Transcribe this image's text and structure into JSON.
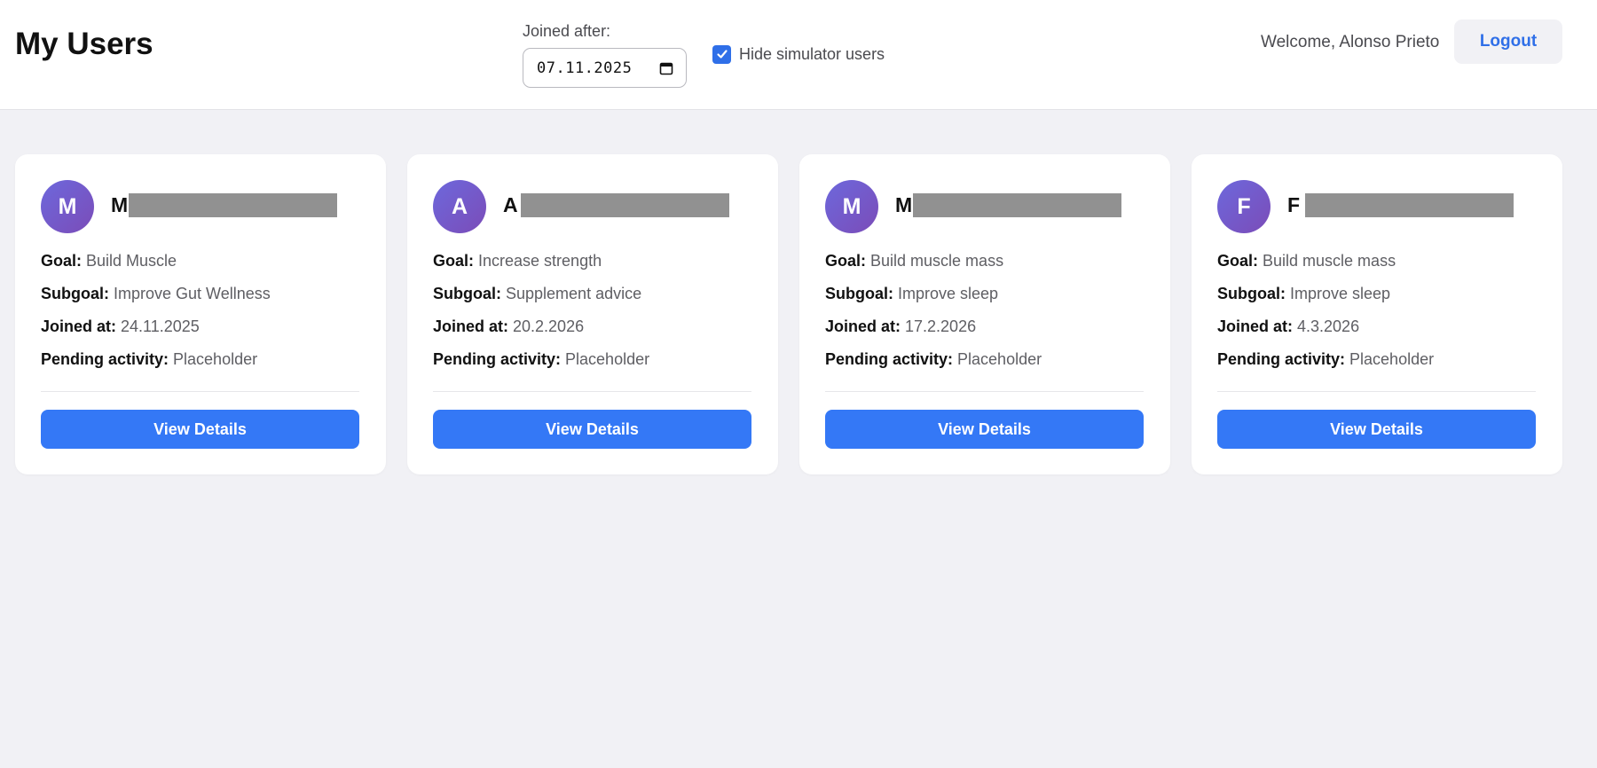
{
  "header": {
    "title": "My Users",
    "filter_label": "Joined after:",
    "date_value": "07.11.2025",
    "hide_simulator_label": "Hide simulator users",
    "hide_simulator_checked": true,
    "welcome": "Welcome, Alonso Prieto",
    "logout_label": "Logout"
  },
  "labels": {
    "goal": "Goal:",
    "subgoal": "Subgoal:",
    "joined": "Joined at:",
    "pending": "Pending activity:",
    "view_details": "View Details"
  },
  "users": [
    {
      "initial": "M",
      "name_visible": "M",
      "goal": "Build Muscle",
      "subgoal": "Improve Gut Wellness",
      "joined": "24.11.2025",
      "pending": "Placeholder"
    },
    {
      "initial": "A",
      "name_visible": "A",
      "goal": "Increase strength",
      "subgoal": "Supplement advice",
      "joined": "20.2.2026",
      "pending": "Placeholder"
    },
    {
      "initial": "M",
      "name_visible": "M",
      "goal": "Build muscle mass",
      "subgoal": "Improve sleep",
      "joined": "17.2.2026",
      "pending": "Placeholder"
    },
    {
      "initial": "F",
      "name_visible": "F",
      "goal": "Build muscle mass",
      "subgoal": "Improve sleep",
      "joined": "4.3.2026",
      "pending": "Placeholder"
    }
  ],
  "colors": {
    "accent": "#3478f6",
    "avatar_gradient_start": "#6d68dc",
    "avatar_gradient_end": "#7b4cb8",
    "background": "#f1f1f5",
    "redaction": "#919191"
  },
  "icons": {
    "date": "calendar-icon",
    "checkbox": "checkmark-icon"
  }
}
